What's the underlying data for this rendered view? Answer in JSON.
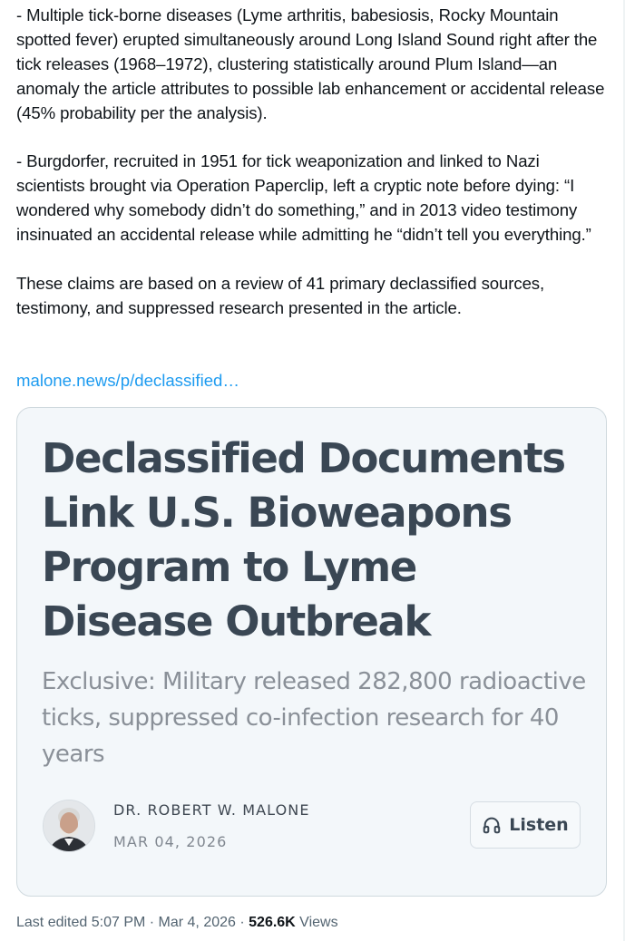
{
  "tweet": {
    "paragraphs": [
      "- Multiple tick-borne diseases (Lyme arthritis, babesiosis, Rocky Mountain spotted fever) erupted simultaneously around Long Island Sound right after the tick releases (1968–1972), clustering statistically around Plum Island—an anomaly the article attributes to possible lab enhancement or accidental release (45% probability per the analysis).",
      "- Burgdorfer, recruited in 1951 for tick weaponization and linked to Nazi scientists brought via Operation Paperclip, left a cryptic note before dying: “I wondered why somebody didn’t do something,” and in 2013 video testimony insinuated an accidental release while admitting he “didn’t tell you everything.”",
      "These claims are based on a review of 41 primary declassified sources, testimony, and suppressed research presented in the article."
    ],
    "link_text": "malone.news/p/declassified…"
  },
  "card": {
    "title": "Declassified Documents Link U.S. Bioweapons Program to Lyme Disease Outbreak",
    "subtitle": "Exclusive: Military released 282,800 radioactive ticks, suppressed co-infection research for 40 years",
    "author": "DR. ROBERT W. MALONE",
    "date": "MAR 04, 2026",
    "listen_label": "Listen",
    "listen_icon": "headphones-icon"
  },
  "meta": {
    "edited": "Last edited 5:07 PM · Mar 4, 2026 · ",
    "views_count": "526.6K",
    "views_label": " Views"
  },
  "colors": {
    "link": "#1d9bf0",
    "card_background": "#f3f7fa",
    "card_title": "#3a4754",
    "secondary_text": "#536471"
  }
}
